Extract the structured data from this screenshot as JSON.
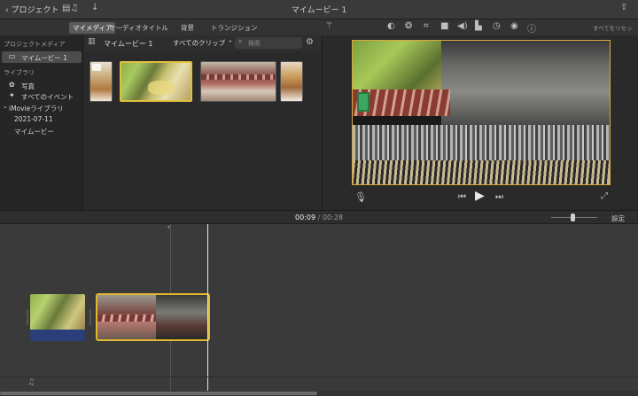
{
  "topbar": {
    "back_label": "プロジェクト",
    "title": "マイムービー 1"
  },
  "tabs": [
    {
      "label": "マイメディア",
      "active": true
    },
    {
      "label": "オーディオ",
      "active": false
    },
    {
      "label": "タイトル",
      "active": false
    },
    {
      "label": "背景",
      "active": false
    },
    {
      "label": "トランジション",
      "active": false
    }
  ],
  "viewer_tools": {
    "reset_all": "すべてをリセット",
    "icons": [
      "magic-wand-icon",
      "color-balance-icon",
      "color-palette-icon",
      "crop-icon",
      "camera-stabilize-icon",
      "volume-icon",
      "equalizer-icon",
      "speed-icon",
      "filter-icon",
      "info-icon"
    ]
  },
  "sidebar": {
    "project_media_header": "プロジェクトメディア",
    "project_item": "マイムービー 1",
    "library_header": "ライブラリ",
    "items": [
      {
        "label": "写真",
        "icon": "flower-icon"
      },
      {
        "label": "すべてのイベント",
        "icon": "star-icon"
      }
    ],
    "library_name": "iMovieライブラリ",
    "events": [
      "2021-07-11",
      "マイムービー"
    ]
  },
  "browser": {
    "project_name": "マイムービー 1",
    "clip_filter": "すべてのクリップ",
    "search_placeholder": "検索"
  },
  "timeline": {
    "current_time": "00:09",
    "separator": "/",
    "total_time": "00:28",
    "settings_label": "設定"
  }
}
